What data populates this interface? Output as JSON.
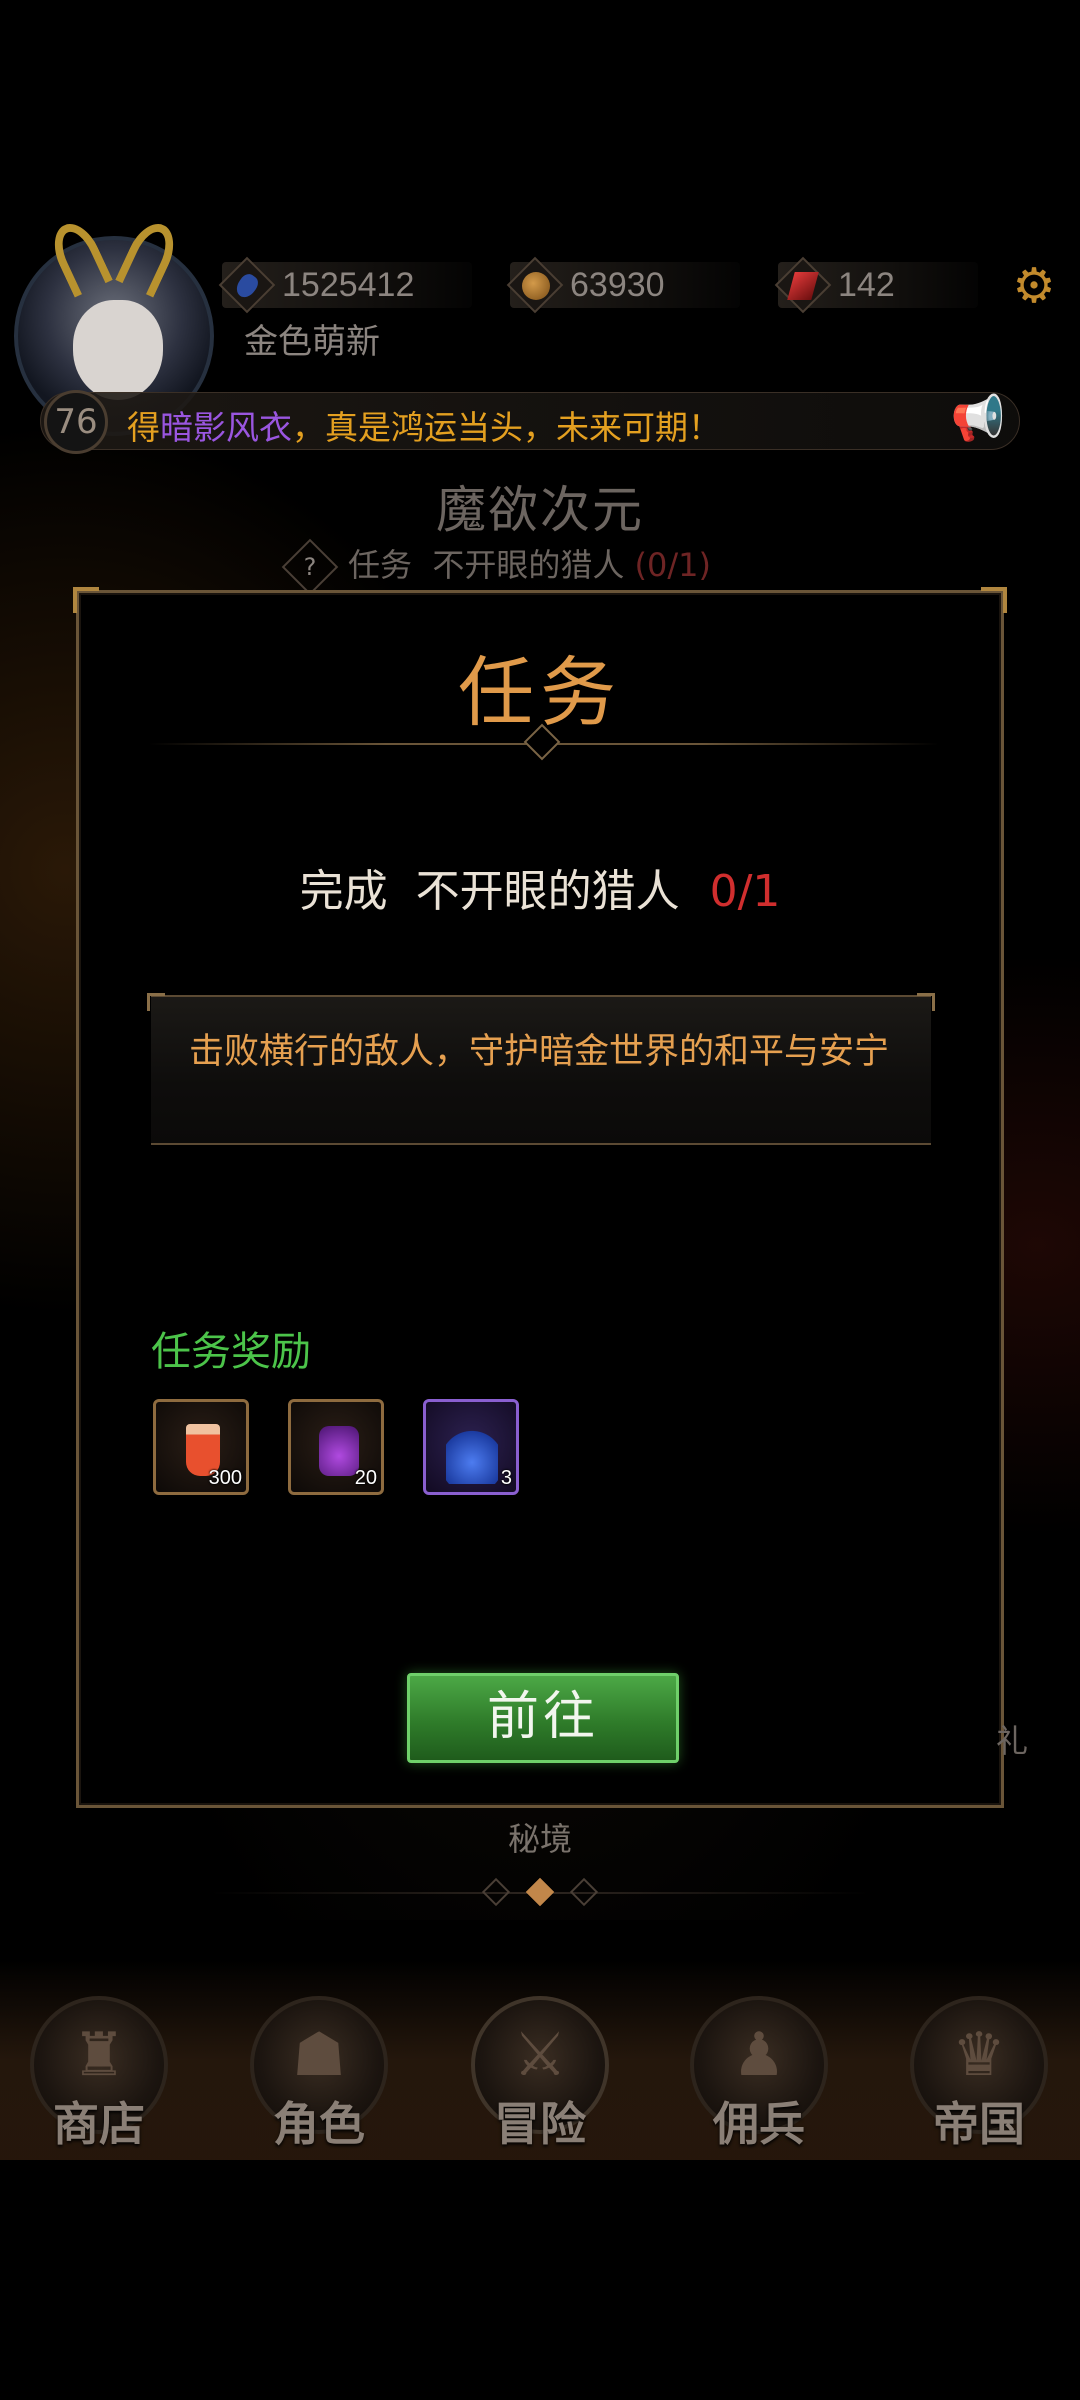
{
  "hud": {
    "level": "76",
    "player_name": "金色萌新",
    "currencies": [
      {
        "icon": "blue-gem-icon",
        "value": "1525412"
      },
      {
        "icon": "coin-icon",
        "value": "63930"
      },
      {
        "icon": "ruby-icon",
        "value": "142"
      }
    ],
    "settings_icon": "gear-icon"
  },
  "broadcast": {
    "prefix": "得",
    "highlight": "暗影风衣",
    "suffix": "，真是鸿运当头，未来可期！"
  },
  "area": {
    "title": "魔欲次元",
    "quest_label": "任务",
    "quest_name": "不开眼的猎人",
    "quest_progress": "(0/1)"
  },
  "modal": {
    "title": "任务",
    "objective_prefix": "完成",
    "objective_target": "不开眼的猎人",
    "objective_count": "0/1",
    "description": "击败横行的敌人，守护暗金世界的和平与安宁",
    "reward_title": "任务奖励",
    "rewards": [
      {
        "icon": "drink-icon",
        "qty": "300"
      },
      {
        "icon": "purple-potion-icon",
        "qty": "20"
      },
      {
        "icon": "blue-flask-icon",
        "qty": "3"
      }
    ],
    "go_label": "前往"
  },
  "side_hint": "礼",
  "secret_label": "秘境",
  "nav": [
    {
      "label": "商店",
      "icon": "shop-icon"
    },
    {
      "label": "角色",
      "icon": "character-icon"
    },
    {
      "label": "冒险",
      "icon": "crossed-swords-icon"
    },
    {
      "label": "佣兵",
      "icon": "mercenary-icon"
    },
    {
      "label": "帝国",
      "icon": "crown-icon"
    }
  ],
  "colors": {
    "accent_gold": "#e09a4a",
    "objective_red": "#d02e2e",
    "reward_green": "#4cc44a",
    "button_green": "#2f7c2a",
    "broadcast_orange": "#e4a020",
    "broadcast_purple": "#9a56e0"
  }
}
